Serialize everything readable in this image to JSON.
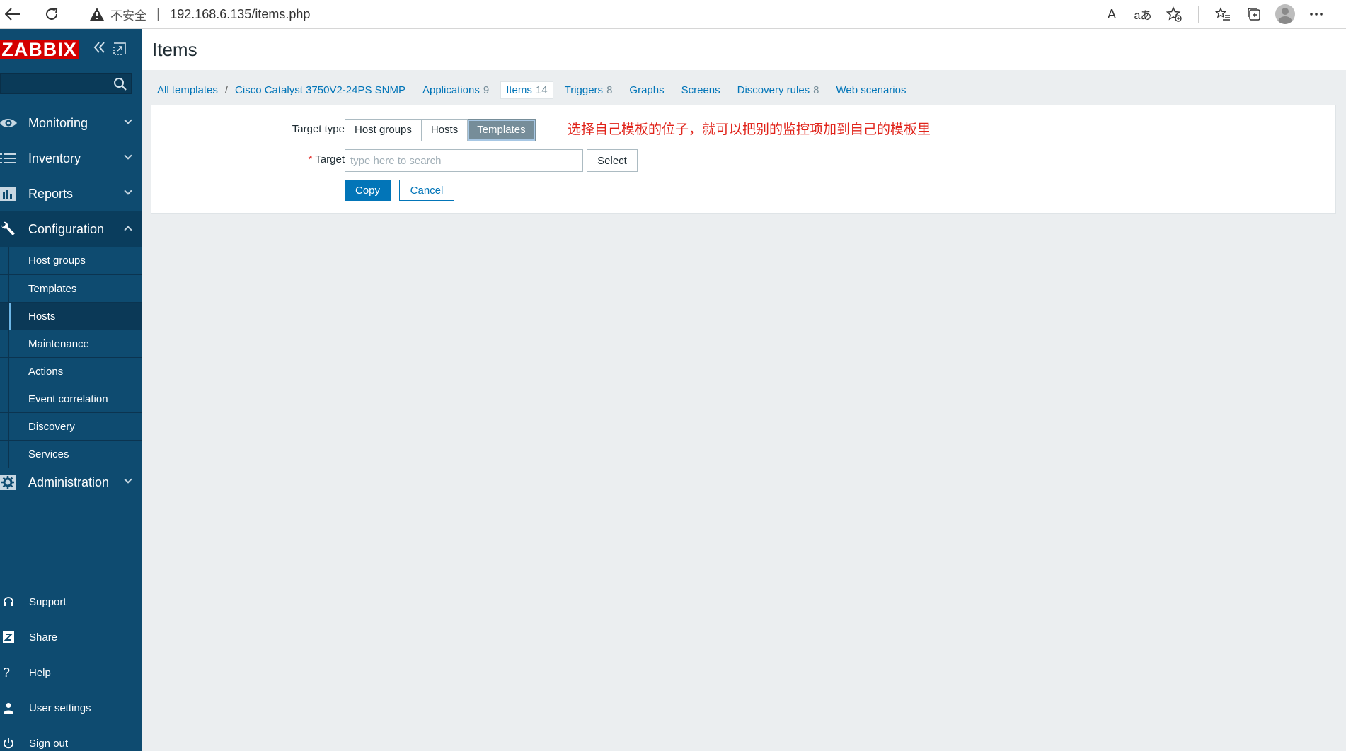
{
  "browser": {
    "insecure_label": "不安全",
    "separator": "|",
    "url": "192.168.6.135/items.php",
    "read_aloud_label": "A",
    "translate_label": "aあ"
  },
  "sidebar": {
    "logo": "ZABBIX",
    "search_placeholder": "",
    "menu": [
      {
        "label": "Monitoring"
      },
      {
        "label": "Inventory"
      },
      {
        "label": "Reports"
      },
      {
        "label": "Configuration"
      },
      {
        "label": "Administration"
      }
    ],
    "config_submenu": [
      {
        "label": "Host groups"
      },
      {
        "label": "Templates"
      },
      {
        "label": "Hosts"
      },
      {
        "label": "Maintenance"
      },
      {
        "label": "Actions"
      },
      {
        "label": "Event correlation"
      },
      {
        "label": "Discovery"
      },
      {
        "label": "Services"
      }
    ],
    "footer": [
      {
        "label": "Support"
      },
      {
        "label": "Share"
      },
      {
        "label": "Help"
      },
      {
        "label": "User settings"
      },
      {
        "label": "Sign out"
      }
    ]
  },
  "page": {
    "title": "Items"
  },
  "breadcrumbs": {
    "all_templates": "All templates",
    "separator": "/",
    "template": "Cisco Catalyst 3750V2-24PS SNMP",
    "tabs": [
      {
        "label": "Applications",
        "count": "9"
      },
      {
        "label": "Items",
        "count": "14"
      },
      {
        "label": "Triggers",
        "count": "8"
      },
      {
        "label": "Graphs",
        "count": ""
      },
      {
        "label": "Screens",
        "count": ""
      },
      {
        "label": "Discovery rules",
        "count": "8"
      },
      {
        "label": "Web scenarios",
        "count": ""
      }
    ]
  },
  "form": {
    "target_type_label": "Target type",
    "target_type_options": [
      "Host groups",
      "Hosts",
      "Templates"
    ],
    "target_type_selected": "Templates",
    "annotation": "选择自己模板的位子，就可以把别的监控项加到自己的模板里",
    "required_mark": "*",
    "target_label": "Target",
    "target_placeholder": "type here to search",
    "select_label": "Select",
    "copy_label": "Copy",
    "cancel_label": "Cancel"
  },
  "colors": {
    "sidebar_bg": "#0e4b70",
    "logo_bg": "#d40000",
    "link": "#0275b8",
    "annotation": "#e0231a",
    "segment_active": "#768d99"
  }
}
